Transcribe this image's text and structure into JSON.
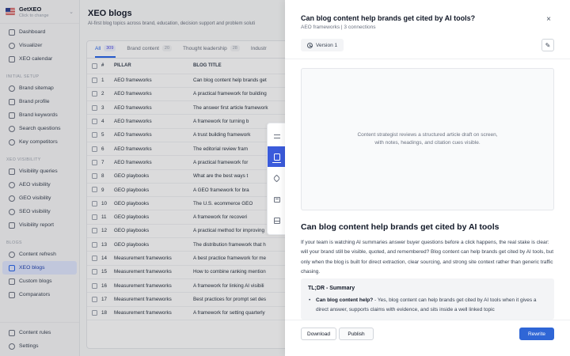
{
  "brand": {
    "name": "GetXEO",
    "subtitle": "Click to change"
  },
  "nav": {
    "top": [
      {
        "label": "Dashboard",
        "icon": "grid-icon"
      },
      {
        "label": "Visualizer",
        "icon": "graph-icon"
      },
      {
        "label": "XEO calendar",
        "icon": "calendar-icon"
      }
    ],
    "initial_setup_label": "INITIAL SETUP",
    "initial_setup": [
      {
        "label": "Brand sitemap",
        "icon": "globe-icon"
      },
      {
        "label": "Brand profile",
        "icon": "profile-icon"
      },
      {
        "label": "Brand keywords",
        "icon": "key-icon"
      },
      {
        "label": "Search questions",
        "icon": "question-icon"
      },
      {
        "label": "Key competitors",
        "icon": "users-icon"
      }
    ],
    "xeo_visibility_label": "XEO VISIBILITY",
    "xeo_visibility": [
      {
        "label": "Visibility queries",
        "icon": "query-icon"
      },
      {
        "label": "AEO visibility",
        "icon": "eye-icon"
      },
      {
        "label": "GEO visibility",
        "icon": "eye-icon"
      },
      {
        "label": "SEO visibility",
        "icon": "eye-icon"
      },
      {
        "label": "Visibility report",
        "icon": "report-icon"
      }
    ],
    "blogs_label": "BLOGS",
    "blogs": [
      {
        "label": "Content refresh",
        "icon": "refresh-icon"
      },
      {
        "label": "XEO blogs",
        "icon": "blog-icon",
        "active": true
      },
      {
        "label": "Custom blogs",
        "icon": "document-icon"
      },
      {
        "label": "Comparators",
        "icon": "compare-icon"
      }
    ],
    "bottom": [
      {
        "label": "Content rules",
        "icon": "rules-icon"
      },
      {
        "label": "Settings",
        "icon": "gear-icon"
      }
    ]
  },
  "main": {
    "title": "XEO blogs",
    "subtitle": "AI-first blog topics across brand, education, decision support and problem soluti",
    "tabs": [
      {
        "label": "All",
        "count": "309",
        "active": true
      },
      {
        "label": "Brand content",
        "count": "20"
      },
      {
        "label": "Thought leadership",
        "count": "28"
      },
      {
        "label": "Industr",
        "count": ""
      }
    ],
    "columns": {
      "num": "#",
      "pillar": "PILLAR",
      "title": "BLOG TITLE"
    },
    "rows": [
      {
        "num": "1",
        "pillar": "AEO frameworks",
        "title": "Can blog content help brands get"
      },
      {
        "num": "2",
        "pillar": "AEO frameworks",
        "title": "A practical framework for building"
      },
      {
        "num": "3",
        "pillar": "AEO frameworks",
        "title": "The answer first article framework"
      },
      {
        "num": "4",
        "pillar": "AEO frameworks",
        "title": "A framework for turning b"
      },
      {
        "num": "5",
        "pillar": "AEO frameworks",
        "title": "A trust building framework"
      },
      {
        "num": "6",
        "pillar": "AEO frameworks",
        "title": "The editorial review fram"
      },
      {
        "num": "7",
        "pillar": "AEO frameworks",
        "title": "A practical framework for"
      },
      {
        "num": "8",
        "pillar": "GEO playbooks",
        "title": "What are the best ways t"
      },
      {
        "num": "9",
        "pillar": "GEO playbooks",
        "title": "A GEO framework for bra"
      },
      {
        "num": "10",
        "pillar": "GEO playbooks",
        "title": "The U.S. ecommerce GEO"
      },
      {
        "num": "11",
        "pillar": "GEO playbooks",
        "title": "A framework for recoveri"
      },
      {
        "num": "12",
        "pillar": "GEO playbooks",
        "title": "A practical method for improving"
      },
      {
        "num": "13",
        "pillar": "GEO playbooks",
        "title": "The distribution framework that h"
      },
      {
        "num": "14",
        "pillar": "Measurement frameworks",
        "title": "A best practice framework for me"
      },
      {
        "num": "15",
        "pillar": "Measurement frameworks",
        "title": "How to combine ranking mention"
      },
      {
        "num": "16",
        "pillar": "Measurement frameworks",
        "title": "A framework for linking AI visibili"
      },
      {
        "num": "17",
        "pillar": "Measurement frameworks",
        "title": "Best practices for prompt set des"
      },
      {
        "num": "18",
        "pillar": "Measurement frameworks",
        "title": "A framework for setting quarterly"
      }
    ]
  },
  "drawer": {
    "title": "Can blog content help brands get cited by AI tools?",
    "meta": "AEO frameworks | 3 connections",
    "version_label": "Version 1",
    "image_placeholder": "Content strategist reviews a structured article draft on screen, with notes, headings, and citation cues visible.",
    "article_title": "Can blog content help brands get cited by AI tools",
    "article_body": "If your team is watching AI summaries answer buyer questions before a click happens, the real stake is clear: will your brand still be visible, quoted, and remembered? Blog content can help brands get cited by AI tools, but only when the blog is built for direct extraction, clear sourcing, and strong site context rather than generic traffic chasing.",
    "tldr_title": "TL;DR - Summary",
    "tldr_q": "Can blog content help?",
    "tldr_a": " - Yes, blog content can help brands get cited by AI tools when it gives a direct answer, supports claims with evidence, and sits inside a well linked topic",
    "buttons": {
      "download": "Download",
      "publish": "Publish",
      "rewrite": "Rewrite"
    },
    "close_glyph": "×",
    "edit_glyph": "✎"
  }
}
